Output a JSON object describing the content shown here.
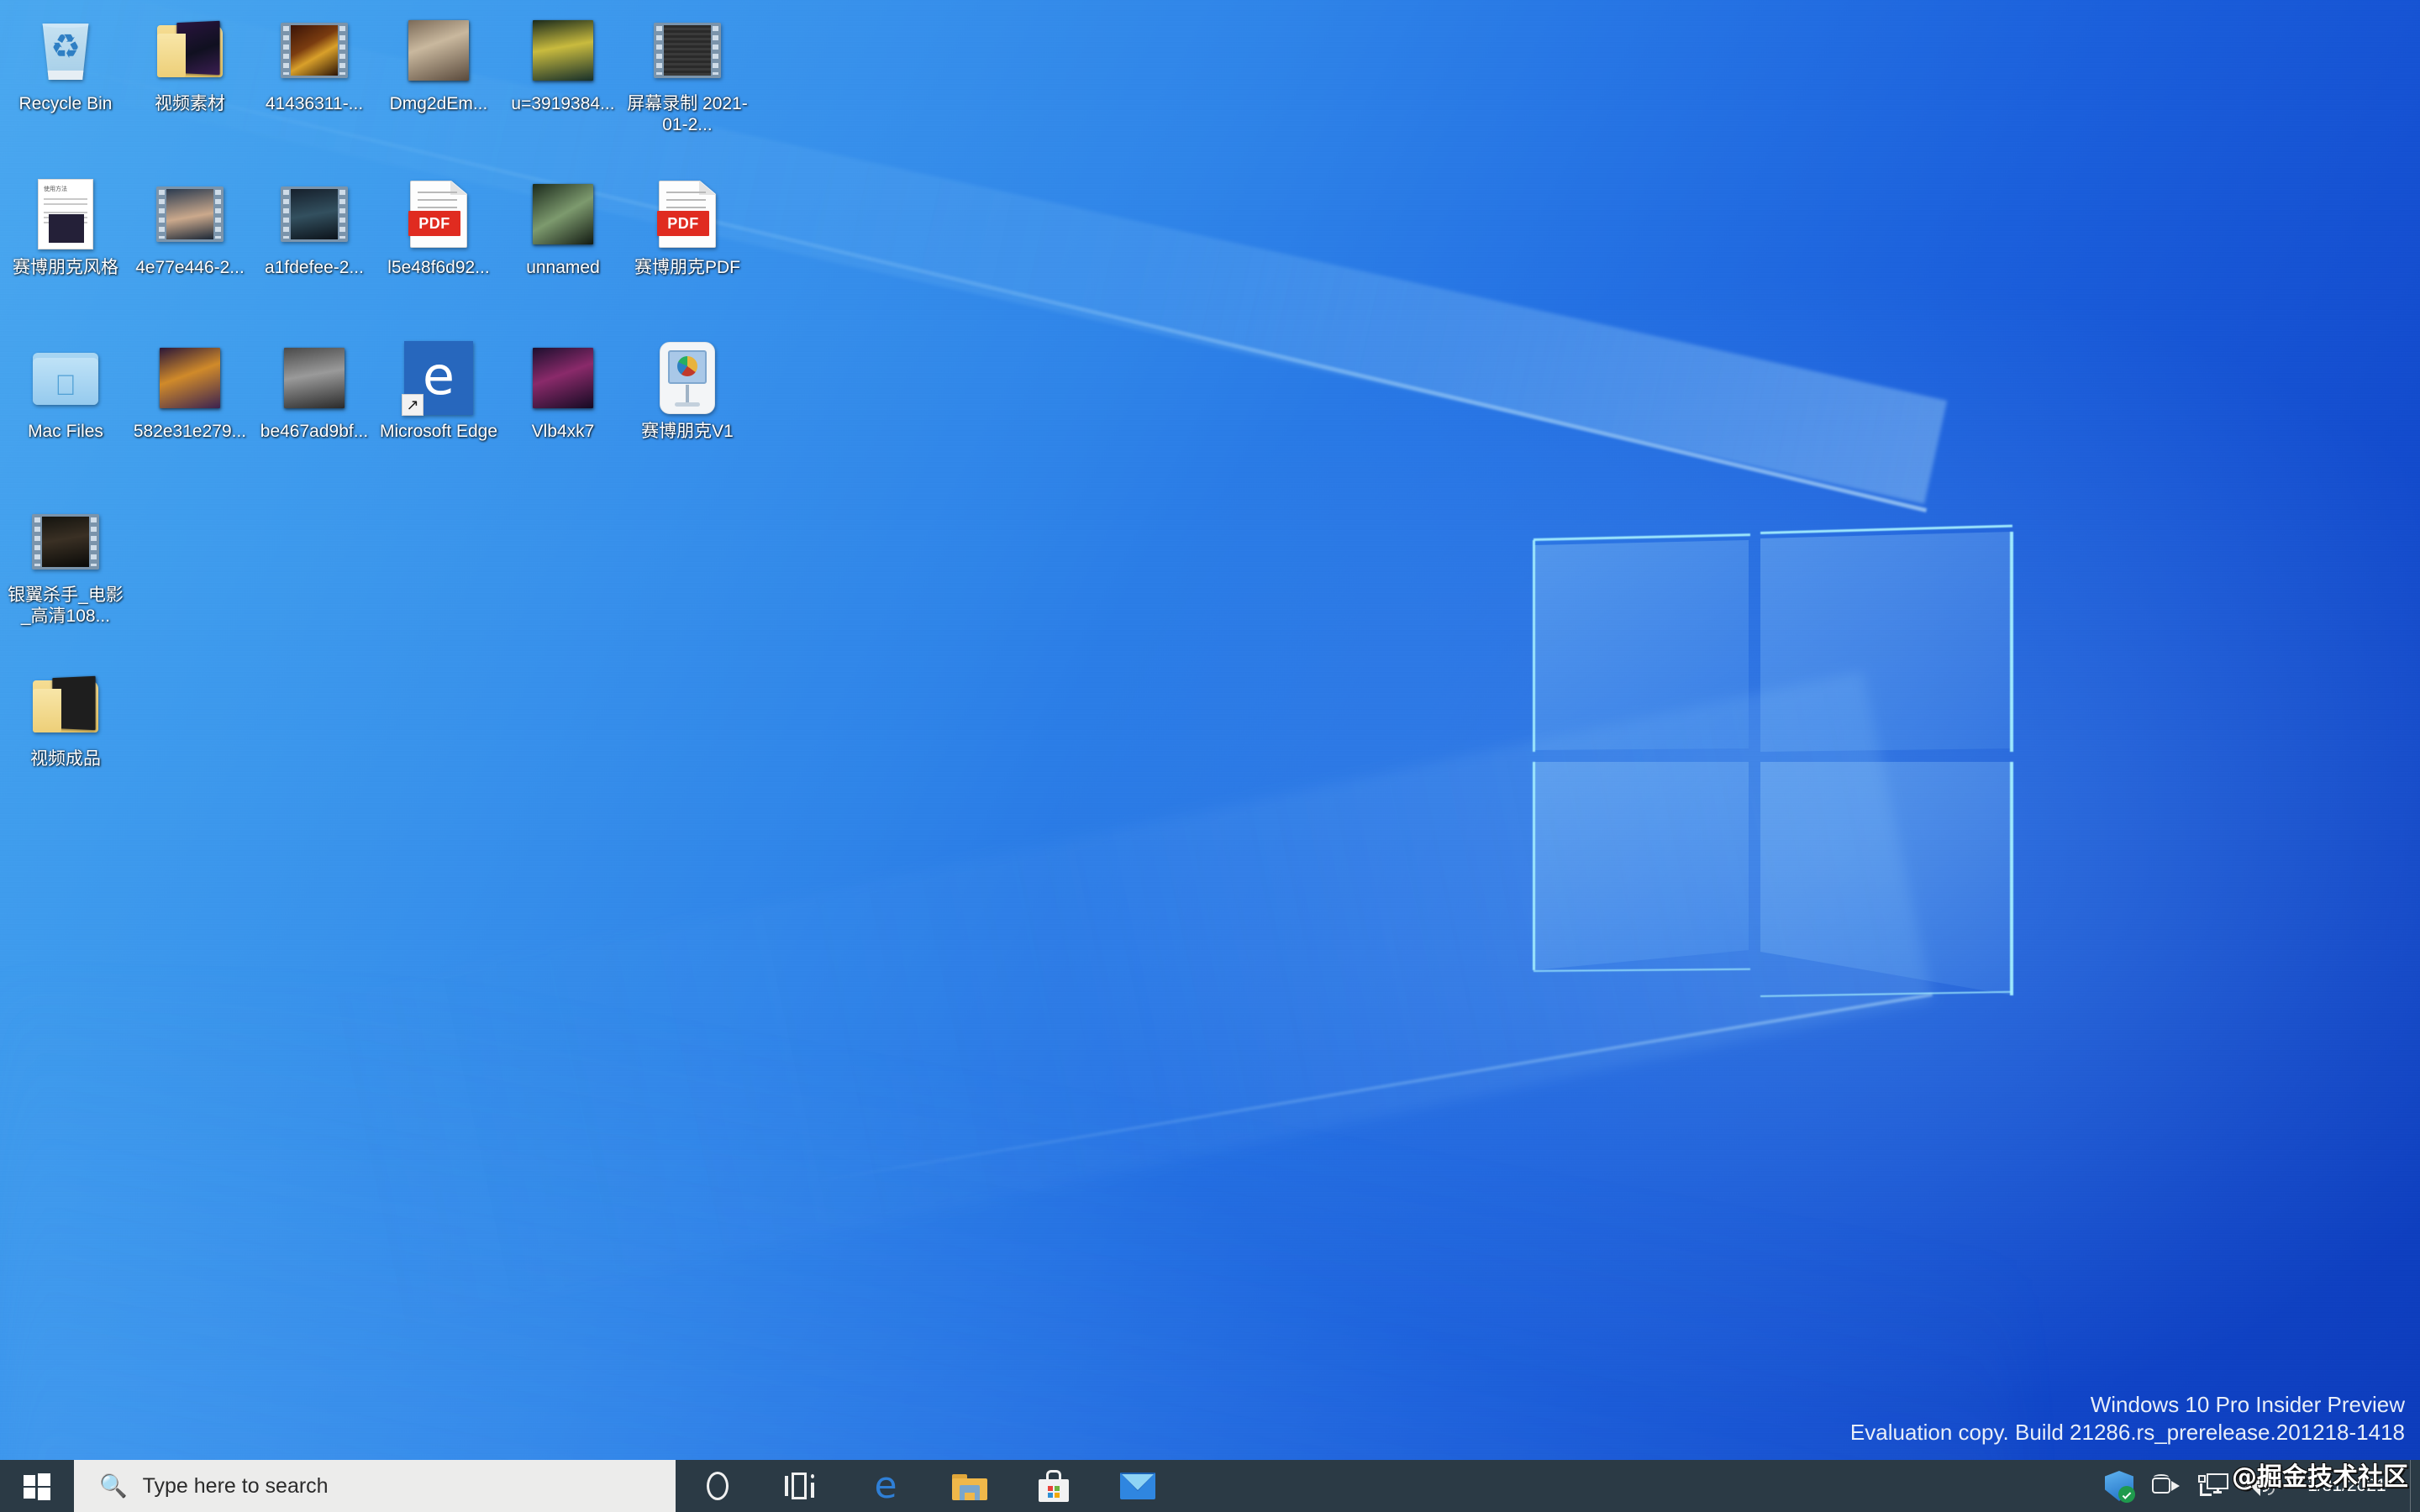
{
  "desktop": {
    "icons": [
      {
        "name": "Recycle Bin",
        "label": "Recycle Bin",
        "art": "recycle",
        "col": 0,
        "row": 0
      },
      {
        "name": "video-materials",
        "label": "视频素材",
        "art": "folder",
        "col": 1,
        "row": 0
      },
      {
        "name": "clip-41436311",
        "label": "41436311-...",
        "art": "film-a",
        "col": 2,
        "row": 0
      },
      {
        "name": "dmg2dem",
        "label": "Dmg2dEm...",
        "art": "photo-a",
        "col": 3,
        "row": 0
      },
      {
        "name": "u-3919384",
        "label": "u=3919384...",
        "art": "photo-b",
        "col": 4,
        "row": 0
      },
      {
        "name": "screen-recording",
        "label": "屏幕录制 2021-01-2...",
        "art": "film-b",
        "col": 5,
        "row": 0
      },
      {
        "name": "cyberpunk-style-doc",
        "label": "赛博朋克风格",
        "art": "doc",
        "col": 0,
        "row": 1
      },
      {
        "name": "clip-4e77e446",
        "label": "4e77e446-2...",
        "art": "film-c",
        "col": 1,
        "row": 1
      },
      {
        "name": "clip-a1fdefee",
        "label": "a1fdefee-2...",
        "art": "film-d",
        "col": 2,
        "row": 1
      },
      {
        "name": "pdf-l5e48f6d92",
        "label": "l5e48f6d92...",
        "art": "pdf",
        "col": 3,
        "row": 1
      },
      {
        "name": "unnamed",
        "label": "unnamed",
        "art": "photo-c",
        "col": 4,
        "row": 1
      },
      {
        "name": "cyberpunk-pdf",
        "label": "赛博朋克PDF",
        "art": "pdf",
        "col": 5,
        "row": 1
      },
      {
        "name": "mac-files",
        "label": "Mac Files",
        "art": "mac-folder",
        "col": 0,
        "row": 2
      },
      {
        "name": "img-582e31e279",
        "label": "582e31e279...",
        "art": "photo-d",
        "col": 1,
        "row": 2
      },
      {
        "name": "img-be467ad9bf",
        "label": "be467ad9bf...",
        "art": "photo-e",
        "col": 2,
        "row": 2
      },
      {
        "name": "microsoft-edge",
        "label": "Microsoft Edge",
        "art": "edge",
        "col": 3,
        "row": 2
      },
      {
        "name": "vib4xk7",
        "label": "Vlb4xk7",
        "art": "photo-f",
        "col": 4,
        "row": 2
      },
      {
        "name": "cyberpunk-v1",
        "label": "赛博朋克V1",
        "art": "keynote",
        "col": 5,
        "row": 2
      },
      {
        "name": "blade-runner-movie",
        "label": "银翼杀手_电影_高清108...",
        "art": "film-e",
        "col": 0,
        "row": 3
      },
      {
        "name": "video-output",
        "label": "视频成品",
        "art": "folder-code",
        "col": 0,
        "row": 4
      }
    ]
  },
  "taskbar": {
    "start_label": "Start",
    "search": {
      "placeholder": "Type here to search",
      "value": "",
      "icon": "search-icon"
    },
    "buttons": [
      {
        "name": "cortana",
        "label": "Cortana",
        "icon": "cortana-circle-icon"
      },
      {
        "name": "task-view",
        "label": "Task View",
        "icon": "task-view-icon"
      },
      {
        "name": "microsoft-edge",
        "label": "Microsoft Edge",
        "icon": "edge-icon"
      },
      {
        "name": "file-explorer",
        "label": "File Explorer",
        "icon": "folder-icon"
      },
      {
        "name": "microsoft-store",
        "label": "Microsoft Store",
        "icon": "store-bag-icon"
      },
      {
        "name": "mail",
        "label": "Mail",
        "icon": "mail-envelope-icon"
      }
    ],
    "tray": [
      {
        "name": "windows-security",
        "label": "Windows Security",
        "icon": "shield-check-icon"
      },
      {
        "name": "camera",
        "label": "Camera",
        "icon": "camera-icon"
      },
      {
        "name": "network",
        "label": "Network",
        "icon": "network-monitor-icon"
      },
      {
        "name": "volume",
        "label": "Volume",
        "icon": "speaker-icon"
      }
    ],
    "clock": {
      "time": "",
      "date": "1/31/2021"
    },
    "watermark_overlay": "@掘金技术社区"
  },
  "os_watermark": {
    "line1": "Windows 10 Pro Insider Preview",
    "line2": "Evaluation copy. Build 21286.rs_prerelease.201218-1418"
  },
  "colors": {
    "taskbar": "#2b3a45",
    "search_box": "#ececeb",
    "accent_blue": "#0078d7",
    "wallpaper_light": "#4aa8f0",
    "wallpaper_dark": "#0c3bbb",
    "pdf_red": "#e02b20",
    "folder_yellow": "#edcf78"
  }
}
